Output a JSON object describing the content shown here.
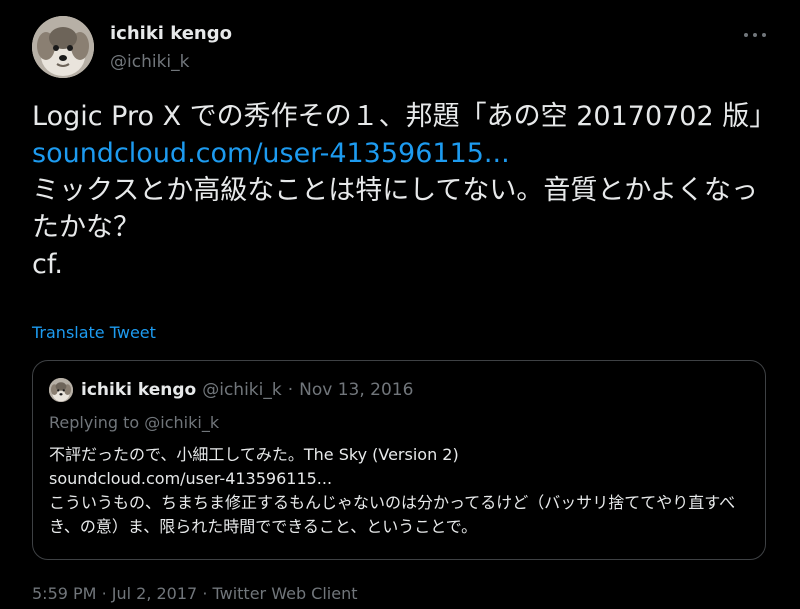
{
  "author": {
    "display_name": "ichiki kengo",
    "handle": "@ichiki_k",
    "avatar_icon": "dog-avatar-icon"
  },
  "more_icon": "more-horizontal-icon",
  "tweet": {
    "line1": "Logic Pro X での秀作その１、邦題「あの空 20170702 版」",
    "link": "soundcloud.com/user-413596115...",
    "line2": "ミックスとか高級なことは特にしてない。音質とかよくなったかな？",
    "line3": "cf."
  },
  "translate_label": "Translate Tweet",
  "quoted": {
    "display_name": "ichiki kengo",
    "handle": "@ichiki_k",
    "separator": "·",
    "date": "Nov 13, 2016",
    "replying_prefix": "Replying to",
    "replying_handle": "@ichiki_k",
    "text_line1": "不評だったので、小細工してみた。The Sky (Version 2)",
    "text_link": "soundcloud.com/user-413596115...",
    "text_line2": "こういうもの、ちまちま修正するもんじゃないのは分かってるけど（バッサリ捨ててやり直すべき、の意）ま、限られた時間でできること、ということで。"
  },
  "footer": {
    "time": "5:59 PM",
    "sep1": "·",
    "date": "Jul 2, 2017",
    "sep2": "·",
    "client": "Twitter Web Client"
  },
  "colors": {
    "background": "#000000",
    "text": "#e7e9ea",
    "secondary": "#71767b",
    "link": "#1d9bf0",
    "border": "#3e4144"
  }
}
